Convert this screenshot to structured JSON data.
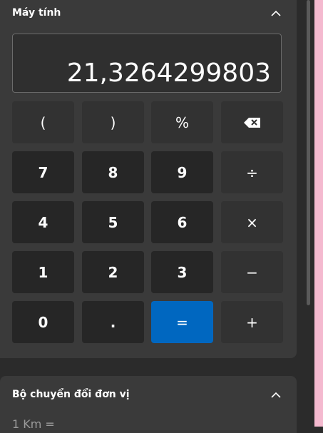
{
  "calculator": {
    "title": "Máy tính",
    "display_value": "21,3264299803",
    "keys": [
      {
        "label": "(",
        "name": "open-paren-key",
        "kind": "op"
      },
      {
        "label": ")",
        "name": "close-paren-key",
        "kind": "op"
      },
      {
        "label": "%",
        "name": "percent-key",
        "kind": "op"
      },
      {
        "label": "",
        "name": "backspace-key",
        "kind": "op",
        "icon": "backspace-icon"
      },
      {
        "label": "7",
        "name": "digit-7-key",
        "kind": "num"
      },
      {
        "label": "8",
        "name": "digit-8-key",
        "kind": "num"
      },
      {
        "label": "9",
        "name": "digit-9-key",
        "kind": "num"
      },
      {
        "label": "÷",
        "name": "divide-key",
        "kind": "op"
      },
      {
        "label": "4",
        "name": "digit-4-key",
        "kind": "num"
      },
      {
        "label": "5",
        "name": "digit-5-key",
        "kind": "num"
      },
      {
        "label": "6",
        "name": "digit-6-key",
        "kind": "num"
      },
      {
        "label": "×",
        "name": "multiply-key",
        "kind": "op"
      },
      {
        "label": "1",
        "name": "digit-1-key",
        "kind": "num"
      },
      {
        "label": "2",
        "name": "digit-2-key",
        "kind": "num"
      },
      {
        "label": "3",
        "name": "digit-3-key",
        "kind": "num"
      },
      {
        "label": "−",
        "name": "subtract-key",
        "kind": "op"
      },
      {
        "label": "0",
        "name": "digit-0-key",
        "kind": "num"
      },
      {
        "label": ".",
        "name": "decimal-key",
        "kind": "num"
      },
      {
        "label": "=",
        "name": "equals-key",
        "kind": "eq"
      },
      {
        "label": "+",
        "name": "add-key",
        "kind": "op"
      }
    ]
  },
  "converter": {
    "title": "Bộ chuyển đổi đơn vị",
    "partial_line": "1 Km ="
  },
  "colors": {
    "accent": "#0067c0",
    "side_strip": "#f4b9cf"
  }
}
